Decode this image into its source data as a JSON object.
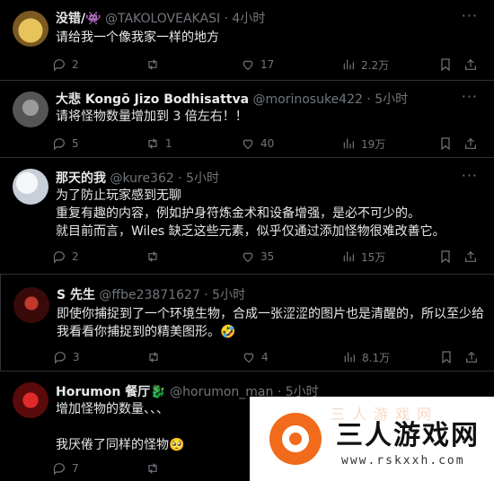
{
  "tweets": [
    {
      "name": "没错/👾",
      "handle": "@TAKOLOVEAKASI",
      "time": "· 4小时",
      "lines": [
        "请给我一个像我家一样的地方"
      ],
      "replies": "2",
      "retweets": "",
      "likes": "17",
      "views": "2.2万",
      "avatar_color": "#c9a24a"
    },
    {
      "name": "大悲 Kongō Jizo Bodhisattva",
      "handle": "@morinosuke422",
      "time": "· 5小时",
      "lines": [
        "请将怪物数量增加到 3 倍左右！！"
      ],
      "replies": "5",
      "retweets": "1",
      "likes": "40",
      "views": "19万",
      "avatar_color": "#8a8a8a"
    },
    {
      "name": "那天的我",
      "handle": "@kure362",
      "time": "· 5小时",
      "lines": [
        "为了防止玩家感到无聊",
        "重复有趣的内容，例如护身符炼金术和设备增强，是必不可少的。",
        "就目前而言，Wiles 缺乏这些元素，似乎仅通过添加怪物很难改善它。"
      ],
      "replies": "2",
      "retweets": "",
      "likes": "35",
      "views": "15万",
      "avatar_color": "#d9dde6"
    },
    {
      "name": "S 先生",
      "handle": "@ffbe23871627",
      "time": "· 5小时",
      "lines": [
        "即使你捕捉到了一个环境生物，合成一张涩涩的图片也是清醒的，所以至少给",
        "我看看你捕捉到的精美图形。🤣"
      ],
      "replies": "3",
      "retweets": "",
      "likes": "4",
      "views": "8.1万",
      "avatar_color": "#7a1a1a"
    },
    {
      "name": "Horumon 餐厅🐉",
      "handle": "@horumon_man",
      "time": "· 5小时",
      "lines": [
        "增加怪物的数量、、、",
        "",
        "我厌倦了同样的怪物🥺"
      ],
      "replies": "7",
      "retweets": "",
      "likes": "",
      "views": "",
      "avatar_color": "#b3151b"
    }
  ],
  "watermark": {
    "title": "三人游戏网",
    "url": "www.rskxxh.com",
    "faint": "三人游戏网"
  },
  "colors": {
    "background": "#000000",
    "text": "#e7e9ea",
    "muted": "#71767b",
    "divider": "#2f3336",
    "watermark_accent": "#f26a1b"
  },
  "icons": [
    "reply-icon",
    "retweet-icon",
    "like-icon",
    "views-icon",
    "bookmark-icon",
    "share-icon",
    "more-icon"
  ]
}
